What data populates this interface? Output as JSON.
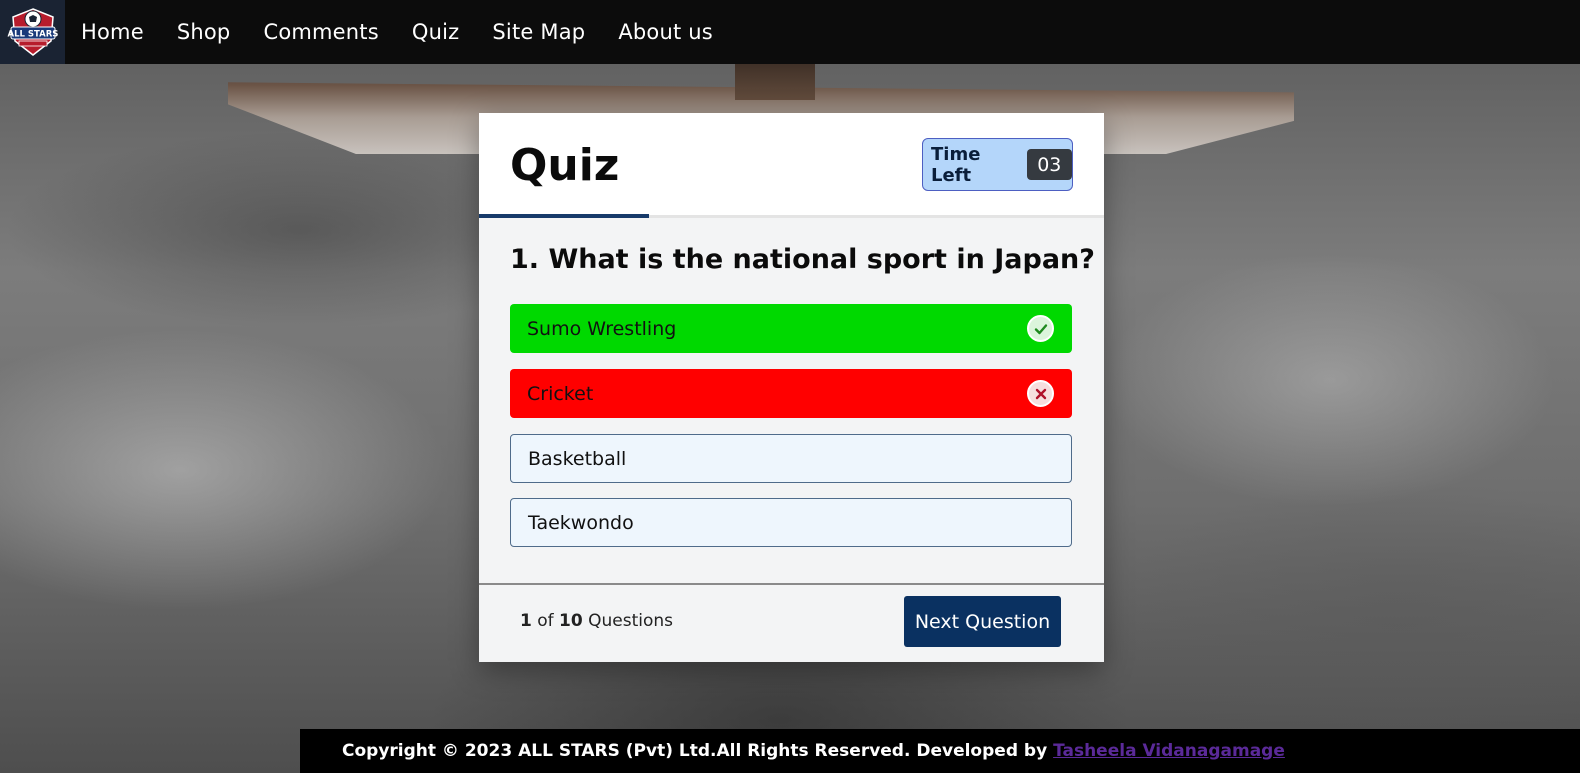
{
  "nav": {
    "logo_text": "ALL STARS",
    "items": [
      "Home",
      "Shop",
      "Comments",
      "Quiz",
      "Site Map",
      "About us"
    ]
  },
  "quiz": {
    "title": "Quiz",
    "timer_label": "Time Left",
    "timer_value": "03",
    "question": "1. What is the national sport in Japan?",
    "options": [
      {
        "label": "Sumo Wrestling",
        "state": "correct",
        "icon": "check-icon"
      },
      {
        "label": "Cricket",
        "state": "wrong",
        "icon": "cross-icon"
      },
      {
        "label": "Basketball",
        "state": "plain"
      },
      {
        "label": "Taekwondo",
        "state": "plain"
      }
    ],
    "progress_current": "1",
    "progress_of": "of",
    "progress_total": "10",
    "progress_suffix": "Questions",
    "next_label": "Next Question"
  },
  "footer": {
    "text": "Copyright © 2023 ALL STARS (Pvt) Ltd.All Rights Reserved. Developed by ",
    "link_text": "Tasheela Vidanagamage"
  },
  "colors": {
    "correct": "#00d900",
    "wrong": "#ff0000",
    "accent": "#0a3161",
    "timer_bg": "#b4d6fa",
    "link": "#5b2a99"
  }
}
